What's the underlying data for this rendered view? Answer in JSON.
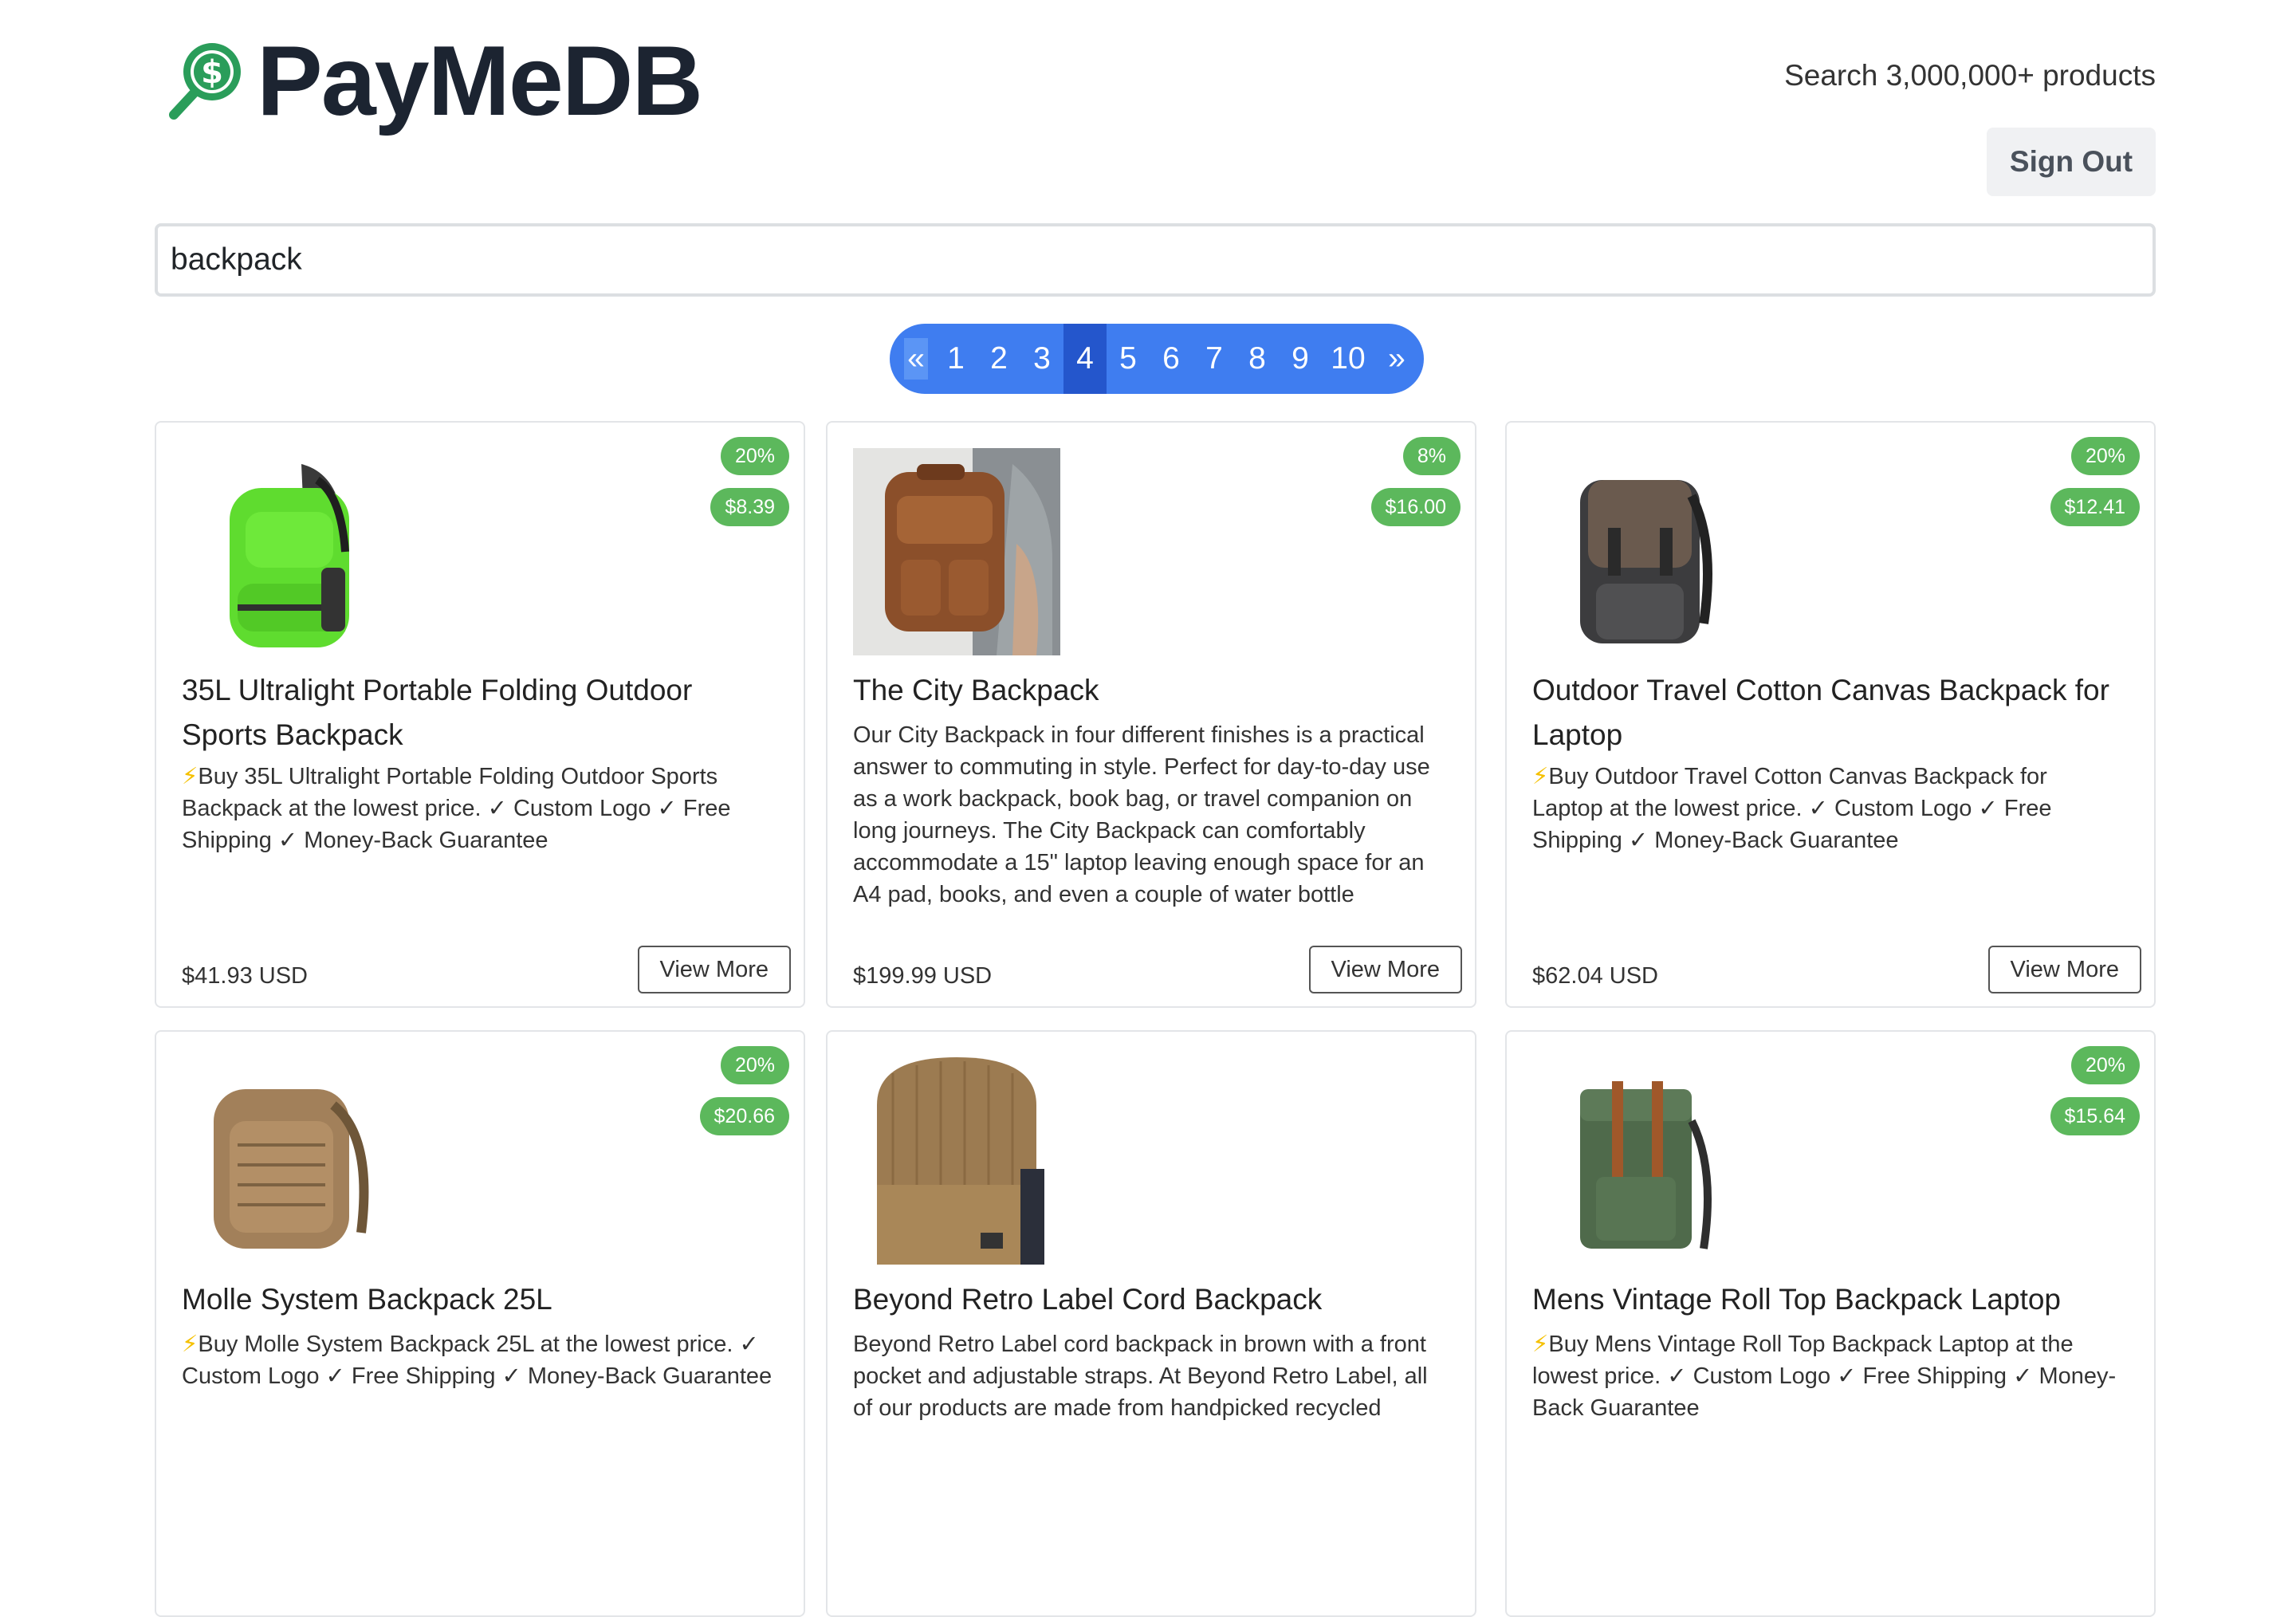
{
  "brand": {
    "name": "PayMeDB"
  },
  "header": {
    "tagline": "Search 3,000,000+ products",
    "signout_label": "Sign Out"
  },
  "search": {
    "value": "backpack"
  },
  "pagination": {
    "prev": "«",
    "next": "»",
    "pages": [
      "1",
      "2",
      "3",
      "4",
      "5",
      "6",
      "7",
      "8",
      "9",
      "10"
    ],
    "active": "4"
  },
  "products": [
    {
      "discount": "20%",
      "savings": "$8.39",
      "title_1": "35L Ultralight Portable Folding Outdoor",
      "title_2": "Sports Backpack",
      "desc_1": "Buy 35L Ultralight Portable Folding Outdoor Sports",
      "desc_2": "Backpack at the lowest price. ✓ Custom Logo ✓ Free",
      "desc_3": "Shipping ✓ Money-Back Guarantee",
      "price": "$41.93 USD",
      "cta": "View More",
      "image": "green-backpack"
    },
    {
      "discount": "8%",
      "savings": "$16.00",
      "title_1": "The City Backpack",
      "title_2": "",
      "desc_1": "Our City Backpack in four different finishes is a practical",
      "desc_2": "answer to commuting in style. Perfect for day-to-day use",
      "desc_3": "as a work backpack, book bag, or travel companion on",
      "desc_4": "long journeys. The City Backpack can comfortably",
      "desc_5": "accommodate a 15\" laptop leaving enough space for an",
      "desc_6": "A4 pad, books, and even a couple of water bottle",
      "price": "$199.99 USD",
      "cta": "View More",
      "image": "leather-backpack"
    },
    {
      "discount": "20%",
      "savings": "$12.41",
      "title_1": "Outdoor Travel Cotton Canvas Backpack for",
      "title_2": "Laptop",
      "desc_1": "Buy Outdoor Travel Cotton Canvas Backpack for",
      "desc_2": "Laptop at the lowest price. ✓ Custom Logo ✓ Free",
      "desc_3": "Shipping ✓ Money-Back Guarantee",
      "price": "$62.04 USD",
      "cta": "View More",
      "image": "canvas-backpack"
    },
    {
      "discount": "20%",
      "savings": "$20.66",
      "title_1": "Molle System Backpack 25L",
      "title_2": "",
      "desc_1": "Buy Molle System Backpack 25L at the lowest price. ✓",
      "desc_2": "Custom Logo ✓ Free Shipping ✓ Money-Back Guarantee",
      "desc_3": "",
      "image": "tactical-backpack"
    },
    {
      "discount": "",
      "savings": "",
      "title_1": "Beyond Retro Label Cord Backpack",
      "title_2": "",
      "desc_1": "Beyond Retro Label cord backpack in brown with a front",
      "desc_2": "pocket and adjustable straps. At Beyond Retro Label, all",
      "desc_3": "of our products are made from handpicked recycled",
      "image": "cord-backpack"
    },
    {
      "discount": "20%",
      "savings": "$15.64",
      "title_1": "Mens Vintage Roll Top Backpack Laptop",
      "title_2": "",
      "desc_1": "Buy Mens Vintage Roll Top Backpack Laptop at the",
      "desc_2": "lowest price. ✓ Custom Logo ✓ Free Shipping ✓ Money-",
      "desc_3": "Back Guarantee",
      "image": "rolltop-backpack"
    }
  ],
  "colors": {
    "badge": "#5cb85c",
    "pagination": "#3f7df0",
    "pagination_active": "#2456cc"
  }
}
